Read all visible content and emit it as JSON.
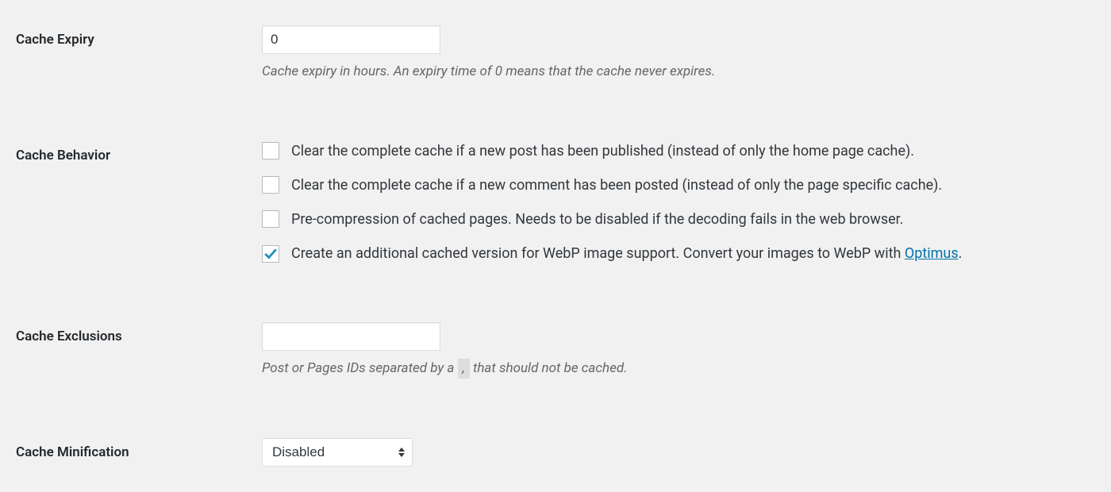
{
  "cache_expiry": {
    "label": "Cache Expiry",
    "value": "0",
    "description": "Cache expiry in hours. An expiry time of 0 means that the cache never expires."
  },
  "cache_behavior": {
    "label": "Cache Behavior",
    "options": [
      {
        "checked": false,
        "text": "Clear the complete cache if a new post has been published (instead of only the home page cache)."
      },
      {
        "checked": false,
        "text": "Clear the complete cache if a new comment has been posted (instead of only the page specific cache)."
      },
      {
        "checked": false,
        "text": "Pre-compression of cached pages. Needs to be disabled if the decoding fails in the web browser."
      },
      {
        "checked": true,
        "text_before_link": "Create an additional cached version for WebP image support. Convert your images to WebP with ",
        "link_text": "Optimus",
        "text_after_link": "."
      }
    ]
  },
  "cache_exclusions": {
    "label": "Cache Exclusions",
    "value": "",
    "description_before": "Post or Pages IDs separated by a ",
    "separator_char": ",",
    "description_after": " that should not be cached."
  },
  "cache_minification": {
    "label": "Cache Minification",
    "selected": "Disabled"
  }
}
